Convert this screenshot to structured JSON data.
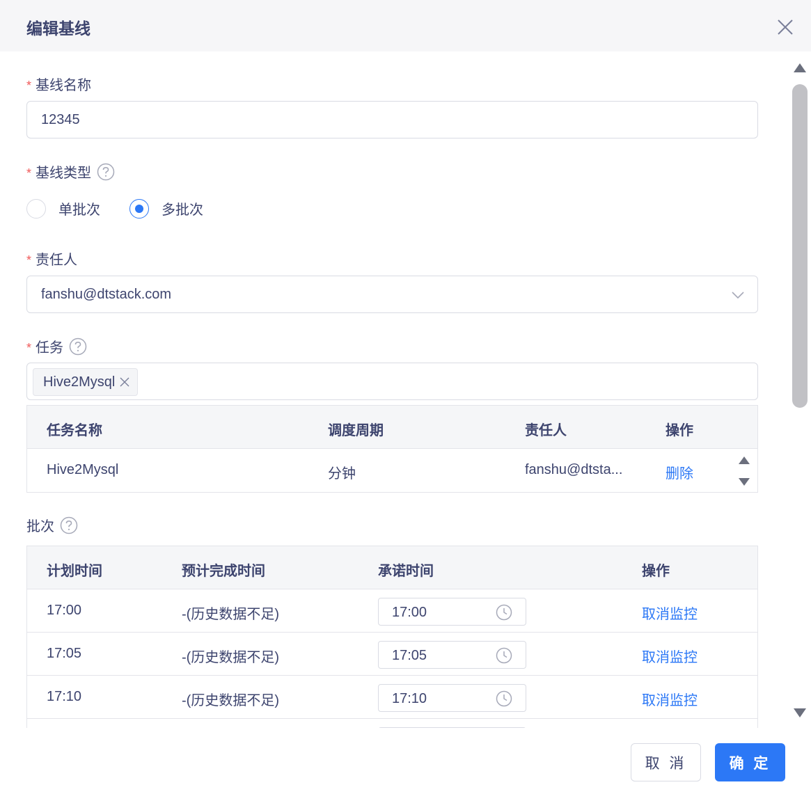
{
  "dialog": {
    "title": "编辑基线",
    "close_icon": "close-icon"
  },
  "form": {
    "name": {
      "label": "基线名称",
      "value": "12345"
    },
    "type": {
      "label": "基线类型",
      "options": [
        {
          "label": "单批次",
          "checked": false
        },
        {
          "label": "多批次",
          "checked": true
        }
      ]
    },
    "owner": {
      "label": "责任人",
      "value": "fanshu@dtstack.com"
    },
    "task": {
      "label": "任务",
      "tags": [
        "Hive2Mysql"
      ],
      "table": {
        "headers": [
          "任务名称",
          "调度周期",
          "责任人",
          "操作"
        ],
        "rows": [
          {
            "name": "Hive2Mysql",
            "cycle": "分钟",
            "owner": "fanshu@dtsta...",
            "action": "删除"
          }
        ]
      }
    },
    "batch": {
      "label": "批次",
      "table": {
        "headers": [
          "计划时间",
          "预计完成时间",
          "承诺时间",
          "操作"
        ],
        "rows": [
          {
            "plan": "17:00",
            "estimate": "-(历史数据不足)",
            "promise": "17:00",
            "action": "取消监控"
          },
          {
            "plan": "17:05",
            "estimate": "-(历史数据不足)",
            "promise": "17:05",
            "action": "取消监控"
          },
          {
            "plan": "17:10",
            "estimate": "-(历史数据不足)",
            "promise": "17:10",
            "action": "取消监控"
          }
        ]
      }
    }
  },
  "footer": {
    "cancel_label": "取 消",
    "ok_label": "确 定"
  },
  "colors": {
    "primary": "#2c78f6",
    "required": "#f05b5b",
    "text": "#3d446e"
  }
}
